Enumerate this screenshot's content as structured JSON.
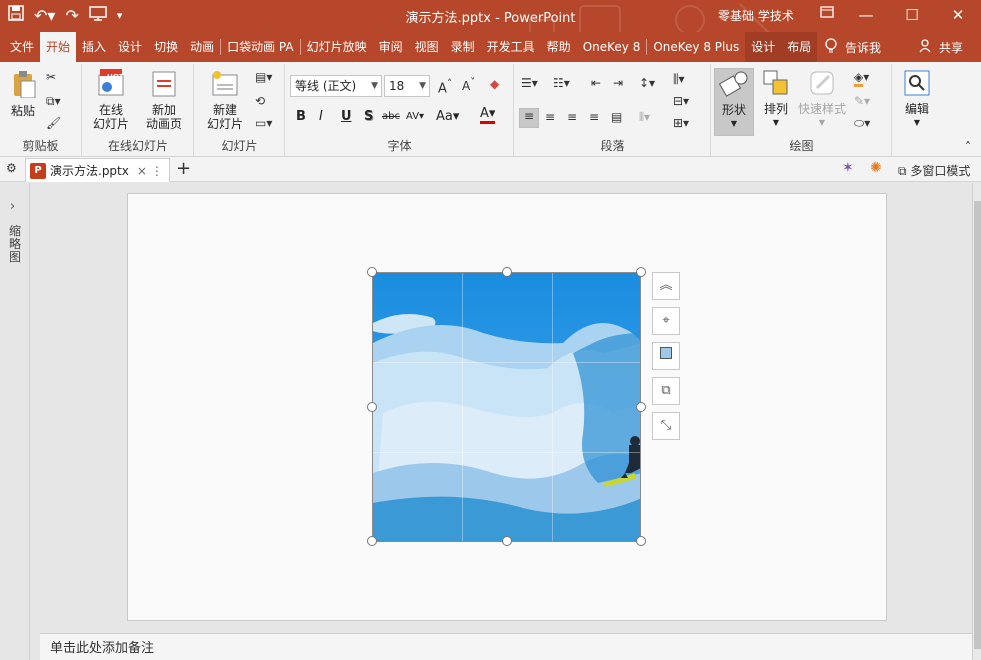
{
  "titlebar": {
    "title": "演示方法.pptx  -  PowerPoint",
    "user": "零基础 学技术",
    "qat": {
      "save_icon": "save-icon",
      "undo_icon": "undo-icon",
      "redo_icon": "redo-icon",
      "present_icon": "present-icon",
      "customize_icon": "customize-icon"
    },
    "window_buttons": {
      "ribbon_display": "ribbon-display-icon",
      "minimize": "minimize-icon",
      "maximize": "maximize-icon",
      "close": "close-icon"
    }
  },
  "tabs": [
    {
      "label": "文件"
    },
    {
      "label": "开始"
    },
    {
      "label": "插入"
    },
    {
      "label": "设计"
    },
    {
      "label": "切换"
    },
    {
      "label": "动画"
    },
    {
      "label": "口袋动画 PA"
    },
    {
      "label": "幻灯片放映"
    },
    {
      "label": "审阅"
    },
    {
      "label": "视图"
    },
    {
      "label": "录制"
    },
    {
      "label": "开发工具"
    },
    {
      "label": "帮助"
    },
    {
      "label": "OneKey 8"
    },
    {
      "label": "OneKey 8 Plus"
    },
    {
      "label": "设计"
    },
    {
      "label": "布局"
    }
  ],
  "tell_me": "告诉我",
  "share": "共享",
  "ribbon": {
    "clipboard": {
      "label": "剪贴板",
      "paste": "粘贴"
    },
    "online_slides": {
      "label": "在线幻灯片",
      "online_btn_1": "在线",
      "online_btn_2": "幻灯片",
      "new_anim_1": "新加",
      "new_anim_2": "动画页",
      "hot_badge": "HOT"
    },
    "slides": {
      "label": "幻灯片",
      "new_slide_1": "新建",
      "new_slide_2": "幻灯片"
    },
    "font": {
      "label": "字体",
      "font_name": "等线 (正文)",
      "font_size": "18",
      "bold": "B",
      "italic": "I",
      "underline": "U",
      "shadow": "S",
      "strike": "abc",
      "spacing": "AV",
      "case": "Aa",
      "font_color": "A"
    },
    "paragraph": {
      "label": "段落"
    },
    "drawing": {
      "label": "绘图",
      "shapes": "形状",
      "arrange": "排列",
      "quick_styles": "快速样式"
    },
    "editing": {
      "label": "编辑"
    }
  },
  "doc_tab": {
    "name": "演示方法.pptx",
    "badge": "P",
    "add": "+",
    "more": "⋮",
    "close": "×"
  },
  "multi_window": "多窗口模式",
  "left_pane": {
    "label": "缩略图",
    "expand": "›"
  },
  "notes_placeholder": "单击此处添加备注",
  "colors": {
    "accent": "#b7472a",
    "ribbon_bg": "#f3f3f3",
    "sky": "#1f8fe0",
    "wave": "#bfe0f6"
  }
}
